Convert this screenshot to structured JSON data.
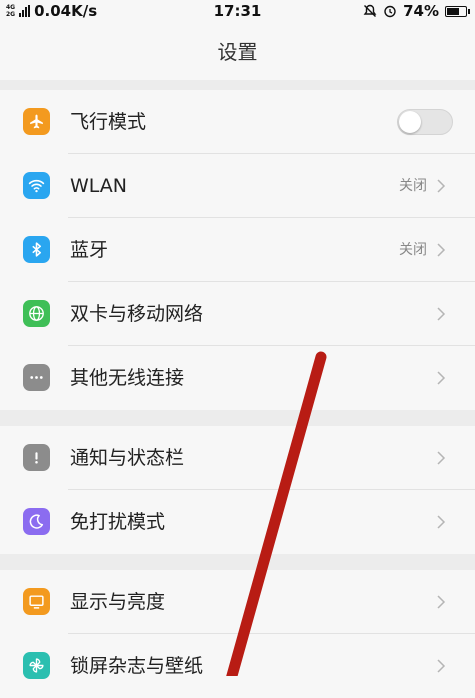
{
  "status_bar": {
    "network_speed": "0.04K/s",
    "time": "17:31",
    "battery": "74%",
    "signal_1": "4G",
    "signal_2": "2G",
    "battery_level": 0.74
  },
  "header": {
    "title": "设置"
  },
  "groups": [
    {
      "items": [
        {
          "label": "飞行模式",
          "icon": "airplane-icon",
          "color": "#f39a1f",
          "toggle": false
        },
        {
          "label": "WLAN",
          "icon": "wifi-icon",
          "color": "#2aa6f0",
          "value": "关闭"
        },
        {
          "label": "蓝牙",
          "icon": "bluetooth-icon",
          "color": "#2aa6f0",
          "value": "关闭"
        },
        {
          "label": "双卡与移动网络",
          "icon": "globe-icon",
          "color": "#3fbf57"
        },
        {
          "label": "其他无线连接",
          "icon": "more-dots-icon",
          "color": "#8c8c8c"
        }
      ]
    },
    {
      "items": [
        {
          "label": "通知与状态栏",
          "icon": "exclamation-icon",
          "color": "#8c8c8c"
        },
        {
          "label": "免打扰模式",
          "icon": "moon-icon",
          "color": "#8b6cf0"
        }
      ]
    },
    {
      "items": [
        {
          "label": "显示与亮度",
          "icon": "monitor-icon",
          "color": "#f39a1f"
        },
        {
          "label": "锁屏杂志与壁纸",
          "icon": "pinwheel-icon",
          "color": "#2bbfb0"
        }
      ]
    }
  ],
  "colors": {
    "annotation_line": "#b81c14",
    "background": "#ececec",
    "row_bg": "#f7f7f7"
  }
}
